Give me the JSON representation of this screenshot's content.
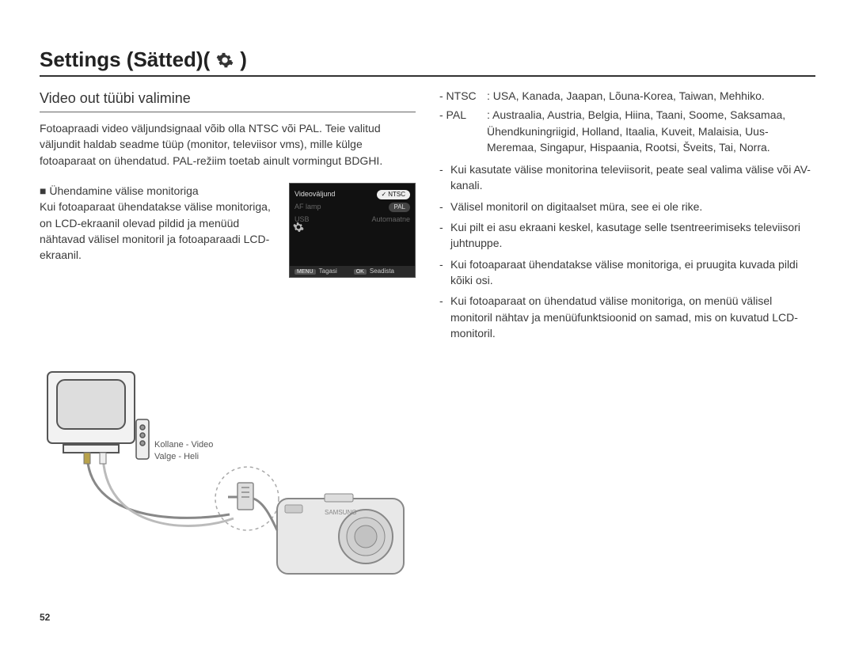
{
  "title_prefix": "Settings (Sätted)(",
  "title_suffix": ")",
  "section": "Video out tüübi valimine",
  "intro": "Fotoapraadi video väljundsignaal võib olla NTSC või PAL. Teie valitud väljundit haldab seadme tüüp (monitor, televiisor vms), mille külge fotoaparaat on ühendatud. PAL-režiim toetab ainult vormingut BDGHI.",
  "bullet_head": "■ Ühendamine välise monitoriga",
  "bullet_body": "Kui fotoaparaat ühendatakse välise monitoriga, on LCD-ekraanil olevad pildid ja menüüd nähtavad välisel monitoril ja fotoaparaadi LCD-ekraanil.",
  "menu": {
    "item1": "Videoväljund",
    "opt1": "NTSC",
    "item2": "AF lamp",
    "opt2": "PAL",
    "item3": "USB",
    "opt3": "Automaatne",
    "back_key": "MENU",
    "back": "Tagasi",
    "ok_key": "OK",
    "ok": "Seadista"
  },
  "defs": {
    "ntsc_term": "- NTSC",
    "ntsc_desc": ": USA, Kanada, Jaapan, Lõuna-Korea, Taiwan, Mehhiko.",
    "pal_term": "- PAL",
    "pal_desc": ": Austraalia, Austria, Belgia, Hiina, Taani, Soome, Saksamaa, Ühendkuningriigid, Holland, Itaalia, Kuveit, Malaisia, Uus-Meremaa, Singapur, Hispaania, Rootsi, Šveits, Tai, Norra."
  },
  "notes": {
    "n1": "Kui kasutate välise monitorina televiisorit, peate seal valima välise või AV-kanali.",
    "n2": "Välisel monitoril on digitaalset müra, see ei ole rike.",
    "n3": "Kui pilt ei asu ekraani keskel, kasutage selle tsentreerimiseks televiisori juhtnuppe.",
    "n4": "Kui fotoaparaat ühendatakse välise monitoriga, ei pruugita kuvada pildi kõiki osi.",
    "n5": "Kui fotoaparaat on ühendatud välise monitoriga, on menüü välisel monitoril nähtav ja menüüfunktsioonid on samad, mis on kuvatud LCD-monitoril."
  },
  "labels": {
    "yellow": "Kollane - Video",
    "white": "Valge - Heli"
  },
  "page_num": "52"
}
